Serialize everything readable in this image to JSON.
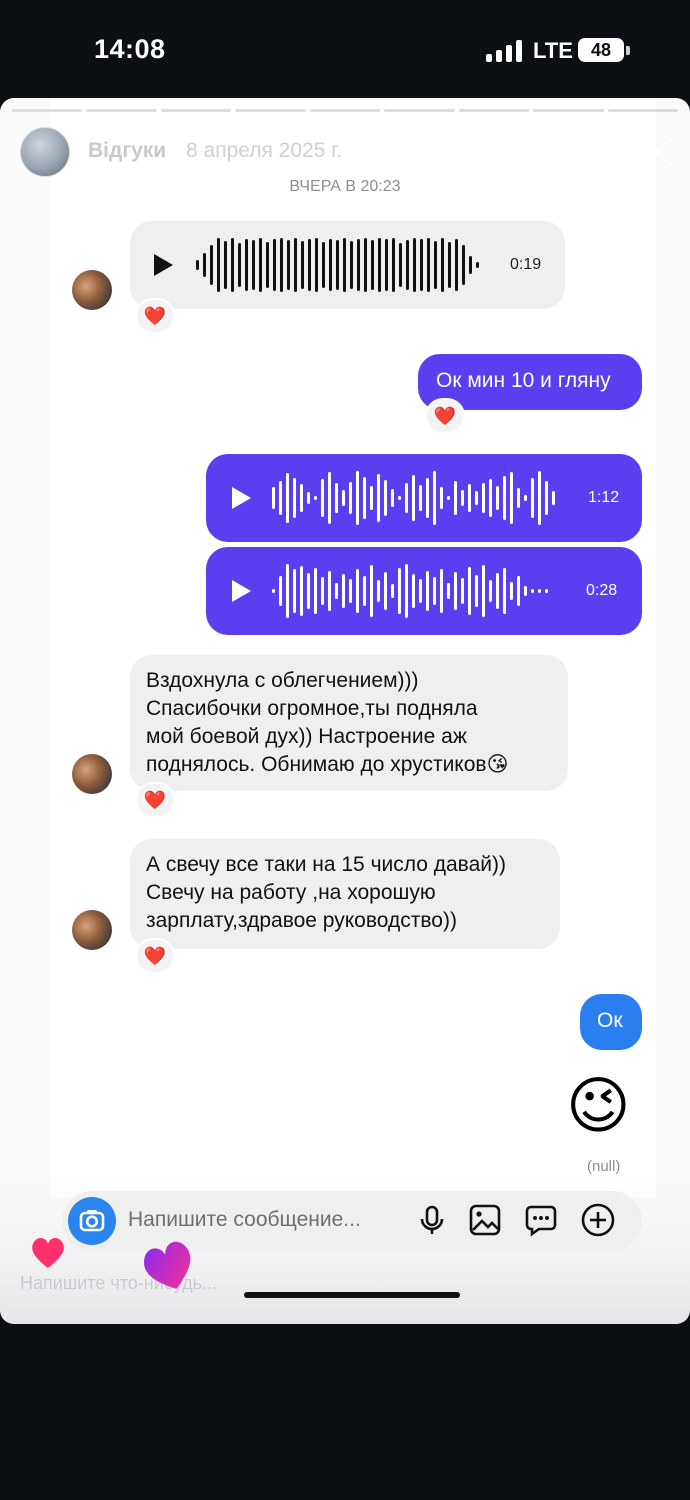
{
  "status_bar": {
    "time": "14:08",
    "network": "LTE",
    "battery": "48"
  },
  "story": {
    "username": "Відгуки",
    "date": "8 апреля 2025 г.",
    "progress_segments": 9,
    "progress_done": 4,
    "reply_placeholder": "Напишите что-нибудь..."
  },
  "chat": {
    "date_separator": "ВЧЕРА В 20:23",
    "messages": [
      {
        "type": "voice",
        "direction": "incoming",
        "duration": "0:19",
        "reaction": "❤️"
      },
      {
        "type": "text",
        "direction": "outgoing",
        "text": "Ок мин 10 и гляну",
        "reaction": "❤️"
      },
      {
        "type": "voice",
        "direction": "outgoing",
        "duration": "1:12"
      },
      {
        "type": "voice",
        "direction": "outgoing",
        "duration": "0:28"
      },
      {
        "type": "text",
        "direction": "incoming",
        "lines": [
          "Вздохнула с облегчением)))",
          "Спасибочки огромное,ты подняла",
          "мой боевой дух)) Настроение аж",
          "поднялось. Обнимаю до хрустиков😘"
        ],
        "reaction": "❤️"
      },
      {
        "type": "text",
        "direction": "incoming",
        "lines": [
          "А свечу все таки на 15 число давай))",
          "Свечу на работу ,на хорошую",
          "зарплату,здравое руководство))"
        ],
        "reaction": "❤️"
      },
      {
        "type": "text",
        "direction": "outgoing",
        "text": "Ок"
      },
      {
        "type": "emoji",
        "direction": "outgoing",
        "emoji": "😉",
        "caption": "(null)"
      }
    ],
    "composer_placeholder": "Напишите сообщение...",
    "icons": [
      "camera-icon",
      "microphone-icon",
      "gallery-icon",
      "sticker-icon",
      "plus-icon"
    ]
  },
  "colors": {
    "outgoing_bubble": "#5a3ef0",
    "incoming_bubble": "#efefef",
    "camera_button": "#2a86ee",
    "heart": "#e8202c"
  }
}
